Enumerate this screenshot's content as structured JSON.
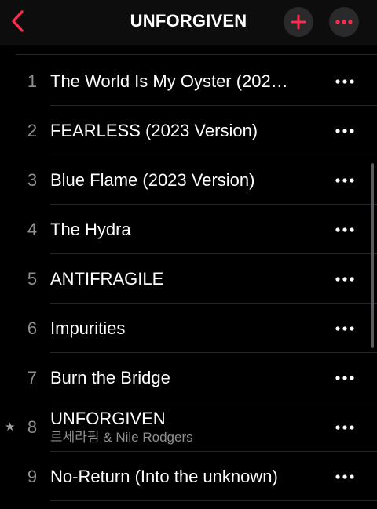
{
  "header": {
    "title": "UNFORGIVEN",
    "back_icon": "chevron-left-icon",
    "add_icon": "plus-icon",
    "more_icon": "ellipsis-icon"
  },
  "colors": {
    "accent": "#fa2d48",
    "background": "#000000",
    "header_background": "#0d0d0d",
    "circle_button": "#2a2a2c",
    "secondary_text": "#8e8e93",
    "divider": "#262628"
  },
  "tracks": [
    {
      "number": "1",
      "title": "The World Is My Oyster (202…",
      "artist": "",
      "starred": false
    },
    {
      "number": "2",
      "title": "FEARLESS (2023 Version)",
      "artist": "",
      "starred": false
    },
    {
      "number": "3",
      "title": "Blue Flame (2023 Version)",
      "artist": "",
      "starred": false
    },
    {
      "number": "4",
      "title": "The Hydra",
      "artist": "",
      "starred": false
    },
    {
      "number": "5",
      "title": "ANTIFRAGILE",
      "artist": "",
      "starred": false
    },
    {
      "number": "6",
      "title": "Impurities",
      "artist": "",
      "starred": false
    },
    {
      "number": "7",
      "title": "Burn the Bridge",
      "artist": "",
      "starred": false
    },
    {
      "number": "8",
      "title": "UNFORGIVEN",
      "artist": "르세라핌 & Nile Rodgers",
      "starred": true,
      "star_glyph": "★"
    },
    {
      "number": "9",
      "title": "No-Return (Into the unknown)",
      "artist": "",
      "starred": false
    }
  ]
}
